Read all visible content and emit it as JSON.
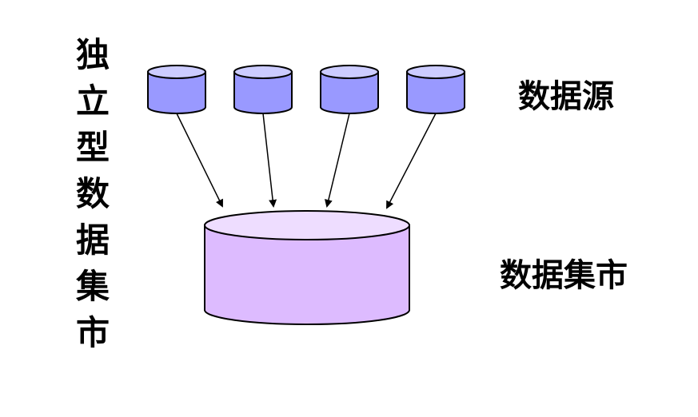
{
  "title_chars": [
    "独",
    "立",
    "型",
    "数",
    "据",
    "集",
    "市"
  ],
  "sources_label": "数据源",
  "mart_label": "数据集市",
  "colors": {
    "source_side": "#9999ff",
    "source_top": "#ccccff",
    "mart_side": "#ddbbff",
    "mart_top": "#eeddff",
    "stroke": "#000000"
  },
  "sources": [
    {
      "id": "source-1"
    },
    {
      "id": "source-2"
    },
    {
      "id": "source-3"
    },
    {
      "id": "source-4"
    }
  ]
}
